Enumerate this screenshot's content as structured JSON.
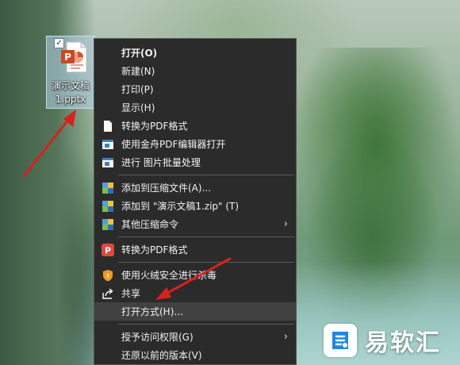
{
  "desktop": {
    "file": {
      "name_line1": "演示文稿",
      "name_line2": "1.pptx",
      "checked": true
    }
  },
  "context_menu": {
    "items": [
      {
        "label": "打开(O)",
        "bold": true,
        "icon": null
      },
      {
        "label": "新建(N)",
        "icon": null
      },
      {
        "label": "打印(P)",
        "icon": null
      },
      {
        "label": "显示(H)",
        "icon": null
      },
      {
        "label": "转换为PDF格式",
        "icon": "document-icon"
      },
      {
        "label": "使用金舟PDF编辑器打开",
        "icon": "pdf-editor-icon"
      },
      {
        "label": "进行 图片批量处理",
        "icon": "image-batch-icon"
      },
      {
        "label": "添加到压缩文件(A)...",
        "icon": "archive-icon"
      },
      {
        "label": "添加到 \"演示文稿1.zip\" (T)",
        "icon": "archive-icon"
      },
      {
        "label": "其他压缩命令",
        "icon": "archive-icon",
        "submenu": true
      },
      {
        "label": "转换为PDF格式",
        "icon": "pdf-convert-icon"
      },
      {
        "label": "使用火绒安全进行杀毒",
        "icon": "huorong-shield-icon"
      },
      {
        "label": "共享",
        "icon": "share-icon"
      },
      {
        "label": "打开方式(H)...",
        "icon": null,
        "highlighted": true
      },
      {
        "label": "授予访问权限(G)",
        "icon": null,
        "submenu": true
      },
      {
        "label": "还原以前的版本(V)",
        "icon": null
      }
    ],
    "submenu_glyph": "›"
  },
  "watermark": {
    "text": "易软汇",
    "color": "#ffffff",
    "badge_color": "#1e88e5"
  },
  "colors": {
    "menu_bg": "#2b2b2b",
    "annotation_red": "#d9201c"
  }
}
